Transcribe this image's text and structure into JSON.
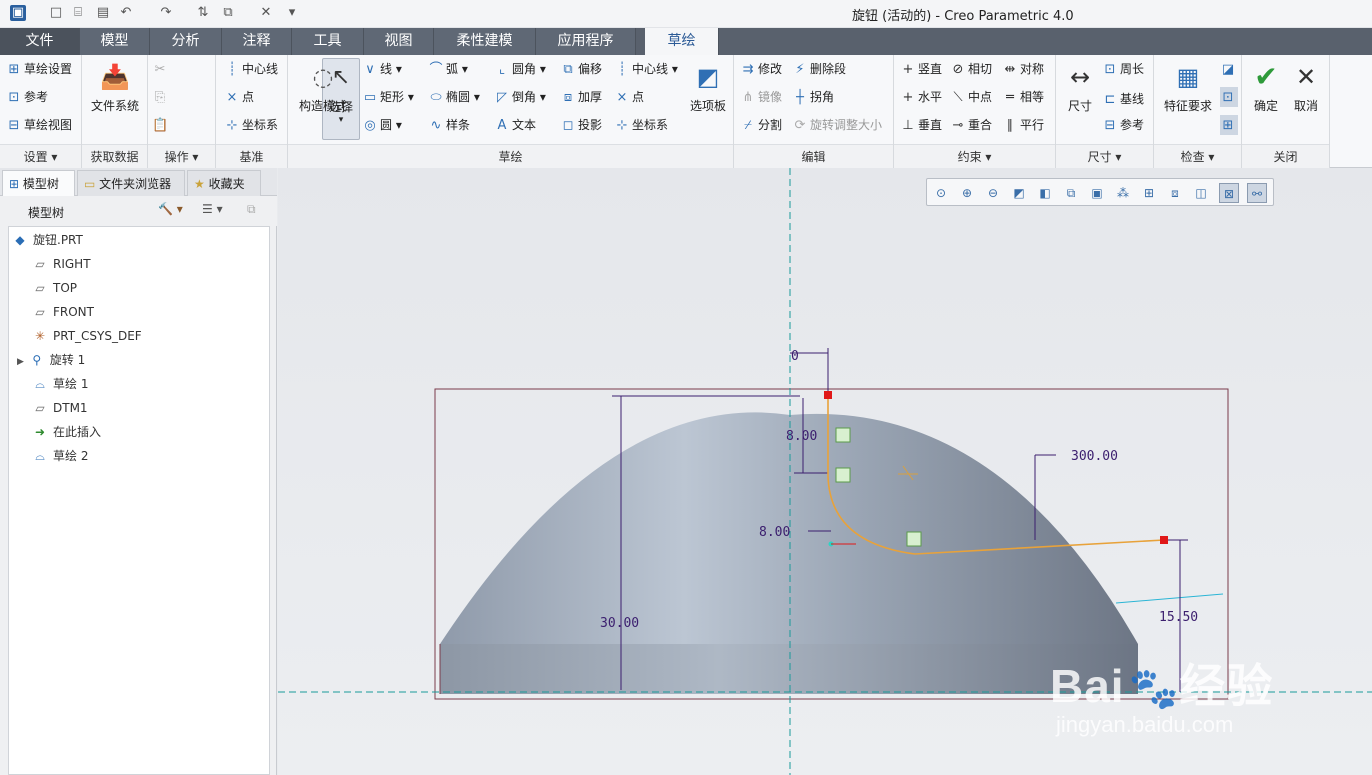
{
  "window": {
    "title": "旋钮 (活动的) - Creo Parametric 4.0"
  },
  "tabs": [
    "文件",
    "模型",
    "分析",
    "注释",
    "工具",
    "视图",
    "柔性建模",
    "应用程序",
    "草绘"
  ],
  "ribbon": {
    "setup": {
      "items": [
        "草绘设置",
        "参考",
        "草绘视图"
      ],
      "label": "设置"
    },
    "get_data": {
      "button": "文件系统",
      "label": "获取数据"
    },
    "operations": {
      "select": "选择",
      "label": "操作"
    },
    "datum": {
      "items": [
        "中心线",
        "点",
        "坐标系"
      ],
      "label": "基准"
    },
    "sketch": {
      "construction": "构造模式",
      "col1": [
        "线",
        "矩形",
        "圆"
      ],
      "col2": [
        "弧",
        "椭圆",
        "样条"
      ],
      "col3": [
        "圆角",
        "倒角",
        "文本"
      ],
      "col4": [
        "偏移",
        "加厚",
        "投影"
      ],
      "col5": [
        "中心线",
        "点",
        "坐标系"
      ],
      "palette": "选项板",
      "label": "草绘"
    },
    "edit": {
      "col1": [
        "修改",
        "镜像",
        "分割"
      ],
      "col2": [
        "删除段",
        "拐角",
        "旋转调整大小"
      ],
      "label": "编辑"
    },
    "constrain": {
      "col1": [
        "竖直",
        "水平",
        "垂直"
      ],
      "col2": [
        "相切",
        "中点",
        "重合"
      ],
      "col3": [
        "对称",
        "相等",
        "平行"
      ],
      "label": "约束"
    },
    "dimension": {
      "button": "尺寸",
      "items": [
        "周长",
        "基线",
        "参考"
      ],
      "label": "尺寸"
    },
    "inspect": {
      "button": "特征要求",
      "label": "检查"
    },
    "close": {
      "ok": "确定",
      "cancel": "取消",
      "label": "关闭"
    }
  },
  "left_panel": {
    "tabs": [
      "模型树",
      "文件夹浏览器",
      "收藏夹"
    ],
    "header": "模型树",
    "tree": [
      {
        "icon": "part-icon",
        "label": "旋钮.PRT"
      },
      {
        "icon": "plane-icon",
        "label": "RIGHT"
      },
      {
        "icon": "plane-icon",
        "label": "TOP"
      },
      {
        "icon": "plane-icon",
        "label": "FRONT"
      },
      {
        "icon": "csys-icon",
        "label": "PRT_CSYS_DEF"
      },
      {
        "icon": "revolve-icon",
        "label": "旋转 1"
      },
      {
        "icon": "sketch-icon",
        "label": "草绘 1"
      },
      {
        "icon": "plane-icon",
        "label": "DTM1"
      },
      {
        "icon": "insert-arrow-icon",
        "label": "在此插入"
      },
      {
        "icon": "sketch-icon",
        "label": "草绘 2"
      }
    ]
  },
  "canvas": {
    "dimensions": {
      "top_offset": "0",
      "arc_height": "8.00",
      "fillet_width": "8.00",
      "total_height": "30.00",
      "radius": "300.00",
      "end_height": "15.50"
    }
  },
  "watermark": {
    "brand": "Bai",
    "brand2": "经验",
    "url": "jingyan.baidu.com"
  },
  "colors": {
    "tab_bar": "#59616d",
    "active_tab": "#f5f6f8",
    "sketch_line": "#e8a23a",
    "dimension": "#3b1e6e",
    "centerline": "#1a9a9a",
    "part_body": "#a7b0bd"
  }
}
